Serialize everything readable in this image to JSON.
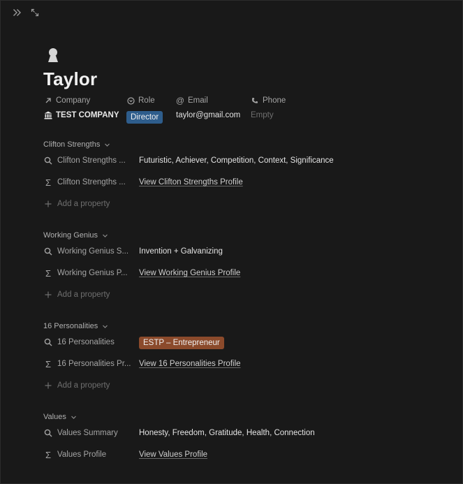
{
  "page": {
    "title": "Taylor",
    "icon": "person-bust-icon"
  },
  "toolbar": {
    "icons": [
      "double-chevron-right-icon",
      "expand-icon"
    ]
  },
  "header_props": {
    "company": {
      "label": "Company",
      "value": "TEST COMPANY",
      "icon": "arrow-up-right-icon"
    },
    "role": {
      "label": "Role",
      "value": "Director",
      "icon": "circle-dot-icon"
    },
    "email": {
      "label": "Email",
      "value": "taylor@gmail.com",
      "icon": "at-icon"
    },
    "phone": {
      "label": "Phone",
      "value": "Empty",
      "icon": "phone-icon"
    }
  },
  "sections": {
    "clifton": {
      "heading": "Clifton Strengths",
      "rows": [
        {
          "name": "Clifton Strengths ...",
          "value": "Futuristic, Achiever, Competition, Context, Significance",
          "icon": "search-icon"
        },
        {
          "name": "Clifton Strengths ...",
          "value": "View Clifton Strengths Profile",
          "icon": "sigma-icon"
        }
      ],
      "add": "Add a property"
    },
    "genius": {
      "heading": "Working Genius",
      "rows": [
        {
          "name": "Working Genius S...",
          "value": "Invention + Galvanizing",
          "icon": "search-icon"
        },
        {
          "name": "Working Genius P...",
          "value": "View Working Genius Profile",
          "icon": "sigma-icon"
        }
      ],
      "add": "Add a property"
    },
    "personalities": {
      "heading": "16 Personalities",
      "rows": [
        {
          "name": "16 Personalities",
          "value": "ESTP – Entrepreneur",
          "icon": "search-icon"
        },
        {
          "name": "16 Personalities Pr...",
          "value": "View 16 Personalities Profile",
          "icon": "sigma-icon"
        }
      ],
      "add": "Add a property"
    },
    "values": {
      "heading": "Values",
      "rows": [
        {
          "name": "Values Summary",
          "value": "Honesty, Freedom, Gratitude, Health, Connection",
          "icon": "search-icon"
        },
        {
          "name": "Values Profile",
          "value": "View Values Profile",
          "icon": "sigma-icon"
        }
      ]
    }
  },
  "colors": {
    "background": "#191919",
    "role_tag": "#2e5d8c",
    "personality_tag": "#8b4a2b"
  }
}
